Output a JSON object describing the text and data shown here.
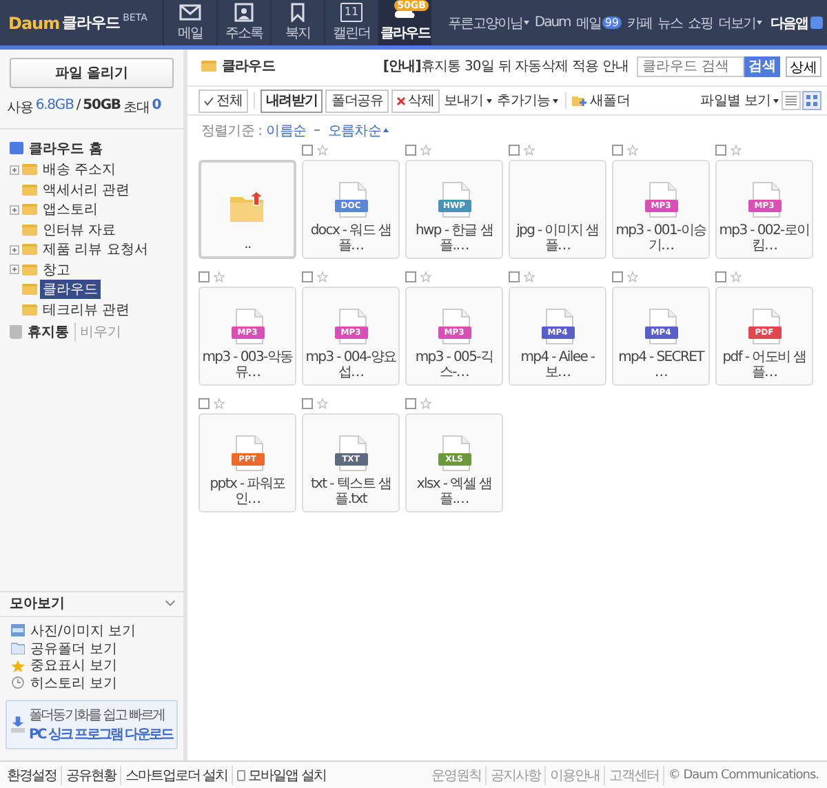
{
  "header": {
    "logo": "Daum",
    "product": "클라우드",
    "beta": "BETA",
    "tabs": [
      {
        "kind": "mail",
        "label": "메일",
        "selected": false
      },
      {
        "kind": "contacts",
        "label": "주소록",
        "selected": false
      },
      {
        "kind": "bookmark",
        "label": "북지",
        "selected": false
      },
      {
        "kind": "calendar",
        "label": "캘린더",
        "day": "11",
        "selected": false
      },
      {
        "kind": "cloud",
        "label": "클라우드",
        "badge": "50GB",
        "selected": true
      }
    ],
    "user": "푸른고양이님",
    "links": [
      {
        "kind": "plain",
        "label": "Daum"
      },
      {
        "kind": "count",
        "label": "메일",
        "count": "99"
      },
      {
        "kind": "plain",
        "label": "카페"
      },
      {
        "kind": "plain",
        "label": "뉴스"
      },
      {
        "kind": "plain",
        "label": "쇼핑"
      },
      {
        "kind": "menu",
        "label": "더보기"
      }
    ],
    "app": "다음앱"
  },
  "sidebar": {
    "upload": "파일 올리기",
    "usage": {
      "label": "사용",
      "used": "6.8GB",
      "slash": "/",
      "total": "50GB",
      "invite_label": "초대",
      "invites": "0"
    },
    "home": "클라우드 홈",
    "folders": [
      {
        "name": "배송 주소지",
        "collapsed": true,
        "selected": false
      },
      {
        "name": "액세서리 관련",
        "collapsed": false,
        "selected": false
      },
      {
        "name": "앱스토리",
        "collapsed": true,
        "selected": false
      },
      {
        "name": "인터뷰 자료",
        "collapsed": false,
        "selected": false
      },
      {
        "name": "제품 리뷰 요청서",
        "collapsed": true,
        "selected": false
      },
      {
        "name": "창고",
        "collapsed": true,
        "selected": false
      },
      {
        "name": "클라우드",
        "collapsed": false,
        "selected": true
      },
      {
        "name": "테크리뷰 관련",
        "collapsed": false,
        "selected": false
      }
    ],
    "trash": "휴지통",
    "empty_trash": "비우기",
    "collections": {
      "title": "모아보기",
      "items": [
        {
          "kind": "photo",
          "label": "사진/이미지 보기"
        },
        {
          "kind": "folder",
          "label": "공유폴더 보기"
        },
        {
          "kind": "star",
          "label": "중요표시 보기"
        },
        {
          "kind": "clock",
          "label": "히스토리 보기"
        }
      ]
    },
    "promo": {
      "line1": "폴더동기화를 쉽고 빠르게",
      "line2": "PC 싱크 프로그램 다운로드"
    }
  },
  "main": {
    "folder": "클라우드",
    "notice": "**[안내]**휴지통 30일 뒤 자동삭제 적용 안내",
    "search": {
      "placeholder": "클라우드 검색",
      "button": "검색",
      "detail": "상세"
    },
    "toolbar": [
      {
        "kind": "select-all",
        "label": "전체"
      },
      {
        "kind": "primary",
        "label": "내려받기"
      },
      {
        "kind": "button",
        "label": "폴더공유"
      },
      {
        "kind": "delete",
        "label": "삭제"
      },
      {
        "kind": "dropdown",
        "label": "보내기"
      },
      {
        "kind": "dropdown",
        "label": "추가기능"
      },
      {
        "kind": "new-folder",
        "label": "새폴더"
      }
    ],
    "view_menu": "파일별 보기",
    "views": [
      {
        "kind": "list",
        "selected": false
      },
      {
        "kind": "grid",
        "selected": true
      }
    ],
    "sort": {
      "label": "정렬기준 :",
      "by": "이름순",
      "order": "오름차순"
    },
    "files": [
      {
        "kind": "parent",
        "name": ".."
      },
      {
        "kind": "file",
        "name": "docx - 워드 샘플…",
        "badge": "DOC",
        "color": "#5b87d4",
        "checked": false,
        "starred": false
      },
      {
        "kind": "file",
        "name": "hwp - 한글 샘플.…",
        "badge": "HWP",
        "color": "#4a93b8",
        "checked": false,
        "starred": false
      },
      {
        "kind": "blank",
        "name": "jpg - 이미지 샘플…",
        "checked": false,
        "starred": false
      },
      {
        "kind": "file",
        "name": "mp3 - 001-이승기…",
        "badge": "MP3",
        "color": "#d84fb5",
        "checked": false,
        "starred": false
      },
      {
        "kind": "file",
        "name": "mp3 - 002-로이킴…",
        "badge": "MP3",
        "color": "#d84fb5",
        "checked": false,
        "starred": false
      },
      {
        "kind": "file",
        "name": "mp3 - 003-악동뮤…",
        "badge": "MP3",
        "color": "#d84fb5",
        "checked": false,
        "starred": false
      },
      {
        "kind": "file",
        "name": "mp3 - 004-양요섭…",
        "badge": "MP3",
        "color": "#d84fb5",
        "checked": false,
        "starred": false
      },
      {
        "kind": "file",
        "name": "mp3 - 005-긱스-…",
        "badge": "MP3",
        "color": "#d84fb5",
        "checked": false,
        "starred": false
      },
      {
        "kind": "file",
        "name": "mp4 - Ailee - 보…",
        "badge": "MP4",
        "color": "#5a5fc8",
        "checked": false,
        "starred": false
      },
      {
        "kind": "file",
        "name": "mp4 - SECRET …",
        "badge": "MP4",
        "color": "#5a5fc8",
        "checked": false,
        "starred": false
      },
      {
        "kind": "file",
        "name": "pdf - 어도비 샘플…",
        "badge": "PDF",
        "color": "#e0474f",
        "checked": false,
        "starred": false
      },
      {
        "kind": "file",
        "name": "pptx - 파워포인…",
        "badge": "PPT",
        "color": "#ee6a2c",
        "checked": false,
        "starred": false
      },
      {
        "kind": "file",
        "name": "txt - 텍스트 샘플.txt",
        "badge": "TXT",
        "color": "#5e6a7f",
        "checked": false,
        "starred": false
      },
      {
        "kind": "file",
        "name": "xlsx - 엑셀 샘플.…",
        "badge": "XLS",
        "color": "#6b9a3e",
        "checked": false,
        "starred": false
      }
    ]
  },
  "footer": {
    "left": [
      {
        "kind": "link",
        "label": "환경설정"
      },
      {
        "kind": "link",
        "label": "공유현황"
      },
      {
        "kind": "link",
        "label": "스마트업로더 설치"
      },
      {
        "kind": "mobile",
        "label": "모바일앱 설치"
      }
    ],
    "right": [
      "운영원칙",
      "공지사항",
      "이용안내",
      "고객센터"
    ],
    "copyright": "© Daum Communications."
  }
}
